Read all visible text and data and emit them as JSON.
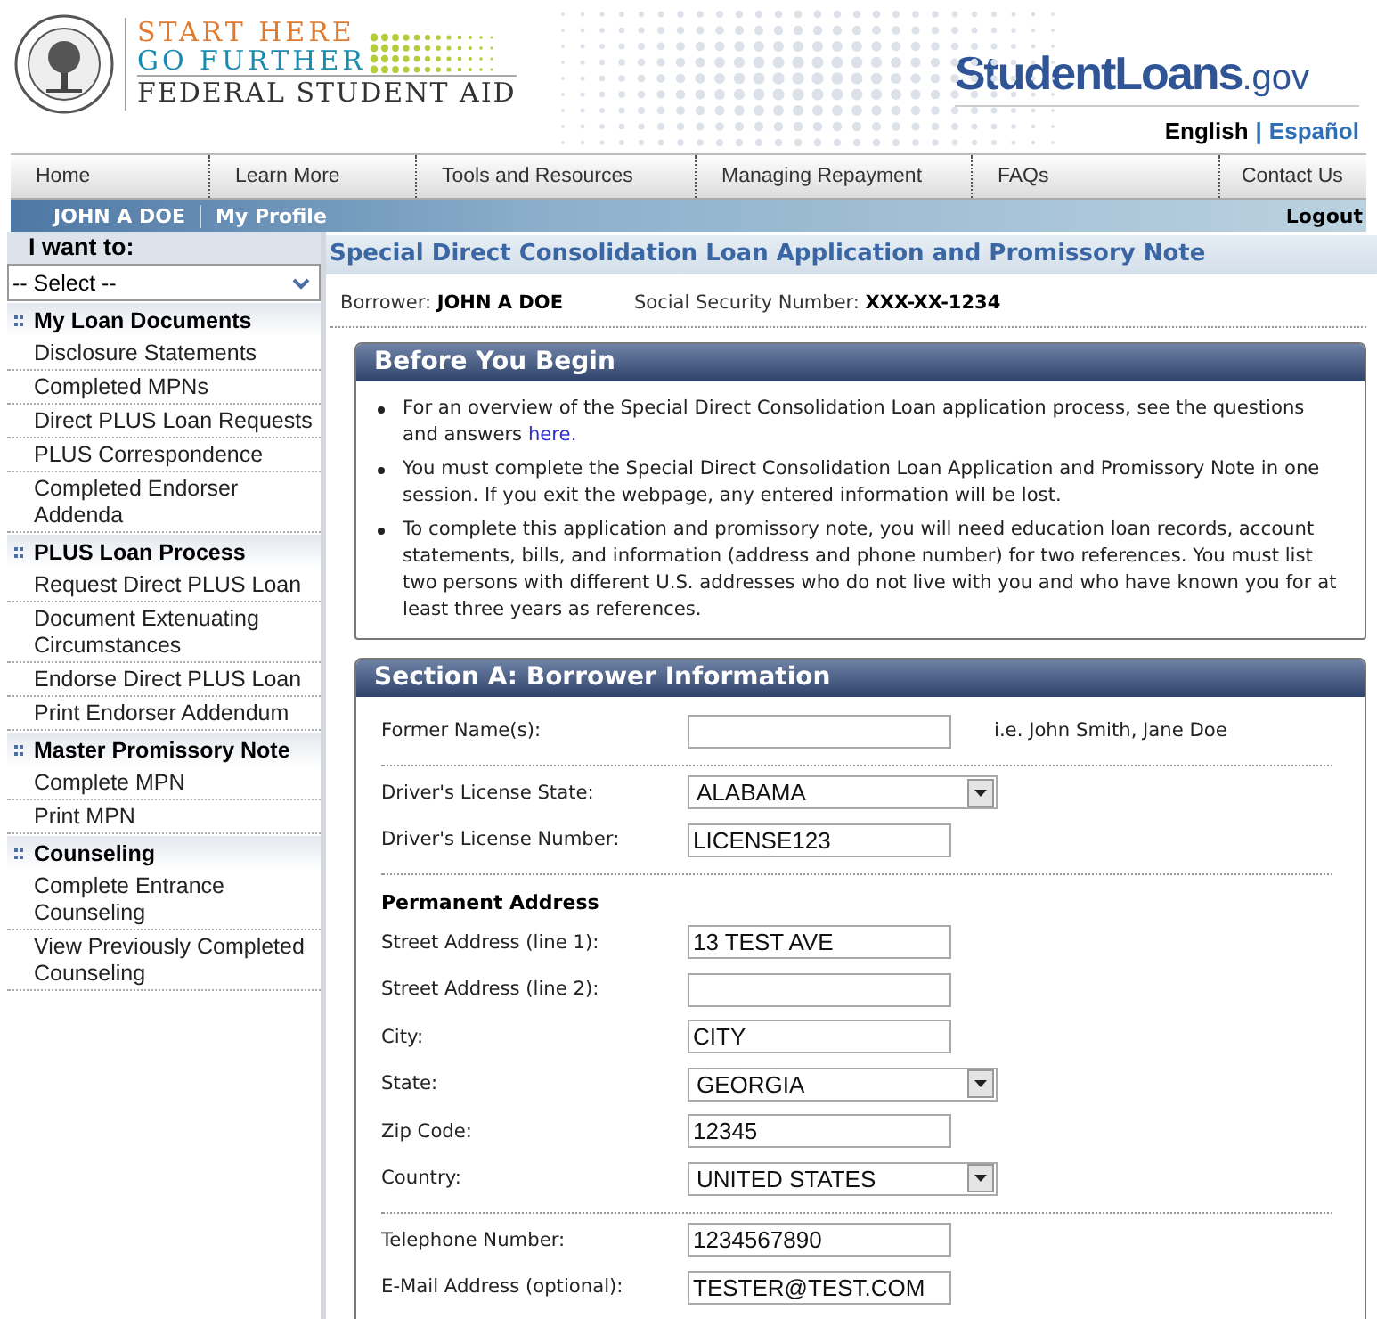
{
  "header": {
    "logo": {
      "line_1": "START HERE",
      "line_2": "GO FURTHER",
      "line_3": "FEDERAL STUDENT AID"
    },
    "site_name": "StudentLoans",
    "site_suffix": ".gov",
    "language_separator": "|",
    "languages": [
      {
        "label": "English",
        "selected": true
      },
      {
        "label": "Español",
        "selected": false
      }
    ]
  },
  "nav": [
    "Home",
    "Learn More",
    "Tools and Resources",
    "Managing Repayment",
    "FAQs",
    "Contact Us"
  ],
  "user_bar": {
    "user": "JOHN A DOE",
    "profile": "My Profile",
    "logout": "Logout"
  },
  "sidebar": {
    "label": "I want to:",
    "select": "-- Select --",
    "groups": [
      {
        "title": "My Loan Documents",
        "items": [
          "Disclosure Statements",
          "Completed MPNs",
          "Direct PLUS Loan Requests",
          "PLUS Correspondence",
          "Completed Endorser Addenda"
        ]
      },
      {
        "title": "PLUS Loan Process",
        "items": [
          "Request Direct PLUS Loan",
          "Document Extenuating Circumstances",
          "Endorse Direct PLUS Loan",
          "Print Endorser Addendum"
        ]
      },
      {
        "title": "Master Promissory Note",
        "items": [
          "Complete MPN",
          "Print MPN"
        ]
      },
      {
        "title": "Counseling",
        "items": [
          "Complete Entrance Counseling",
          "View Previously Completed Counseling"
        ]
      }
    ]
  },
  "page_title": "Special Direct Consolidation Loan Application and Promissory Note",
  "borrower": {
    "label": "Borrower:",
    "name": "JOHN A DOE",
    "ssn_label": "Social Security Number:",
    "ssn": "XXX-XX-1234"
  },
  "before_you_begin": {
    "title": "Before You Begin",
    "bullets": [
      {
        "text": "For an overview of the Special Direct Consolidation Loan application process, see the questions and answers ",
        "link": "here."
      },
      {
        "text": "You must complete the Special Direct Consolidation Loan Application and Promissory Note in one session. If you exit the webpage, any entered information will be lost."
      },
      {
        "text": "To complete this application and promissory note, you will need education loan records, account statements, bills, and information (address and phone number) for two references. You must list two persons with different U.S. addresses who do not live with you and who have known you for at least three years as references."
      }
    ]
  },
  "section_a": {
    "title": "Section A: Borrower Information",
    "groups": [
      {
        "fields": [
          {
            "label": "Former Name(s):",
            "kind": "text",
            "hint": "i.e. John Smith, Jane Doe"
          }
        ]
      },
      {
        "fields": [
          {
            "label": "Driver's License State:",
            "kind": "select",
            "value": "ALABAMA"
          },
          {
            "label": "Driver's License Number:",
            "kind": "text",
            "value": "LICENSE123"
          }
        ]
      },
      {
        "heading": "Permanent Address",
        "fields": [
          {
            "label": "Street Address (line 1):",
            "kind": "text",
            "value": "13 TEST AVE"
          },
          {
            "label": "Street Address (line 2):",
            "kind": "text"
          },
          {
            "label": "City:",
            "kind": "text",
            "value": "CITY"
          },
          {
            "label": "State:",
            "kind": "select",
            "value": "GEORGIA"
          },
          {
            "label": "Zip Code:",
            "kind": "text",
            "value": "12345"
          },
          {
            "label": "Country:",
            "kind": "select",
            "value": "UNITED STATES"
          }
        ]
      },
      {
        "fields": [
          {
            "label": "Telephone Number:",
            "kind": "text",
            "value": "1234567890"
          },
          {
            "label": "E-Mail Address (optional):",
            "kind": "text",
            "value": "TESTER@TEST.COM"
          }
        ]
      }
    ]
  }
}
